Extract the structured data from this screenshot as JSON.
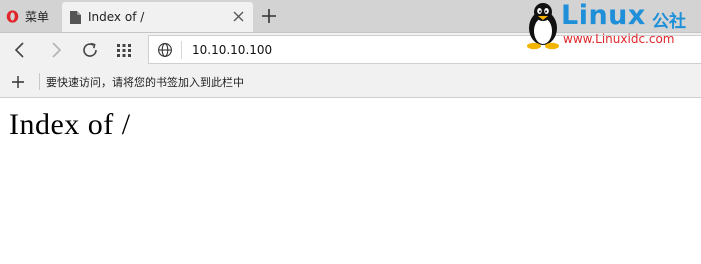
{
  "window": {
    "menu_label": "菜单"
  },
  "tabs": [
    {
      "title": "Index of /"
    }
  ],
  "address_bar": {
    "url": "10.10.10.100"
  },
  "bookmarks_bar": {
    "hint": "要快速访问，请将您的书签加入到此栏中"
  },
  "page": {
    "heading": "Index of /"
  },
  "watermark": {
    "brand": "Linux",
    "brand_cn": "公社",
    "site": "www.Linuxidc.com"
  },
  "colors": {
    "tabstrip": "#d3d3d3",
    "toolbar": "#f1f1f1",
    "opera_red": "#e0262a",
    "watermark_blue": "#1e8fd8",
    "watermark_red": "#e0262a"
  },
  "icons": [
    "opera-logo-icon",
    "document-icon",
    "close-icon",
    "plus-icon",
    "back-arrow-icon",
    "forward-arrow-icon",
    "reload-icon",
    "speed-dial-grid-icon",
    "globe-icon",
    "tux-penguin-icon"
  ]
}
